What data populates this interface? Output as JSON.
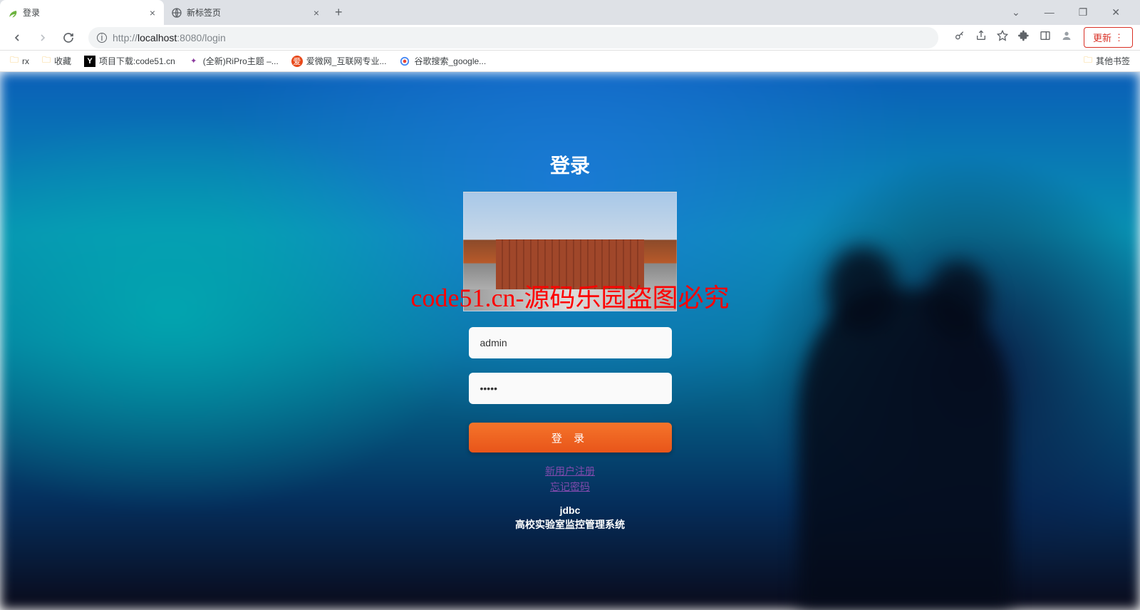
{
  "browser": {
    "tabs": [
      {
        "title": "登录",
        "active": true,
        "favicon": "leaf"
      },
      {
        "title": "新标签页",
        "active": false,
        "favicon": "globe"
      }
    ],
    "url_protocol": "http://",
    "url_host": "localhost",
    "url_port": ":8080",
    "url_path": "/login",
    "update_label": "更新",
    "window_controls": {
      "dropdown": "⌄",
      "minimize": "—",
      "maximize": "❐",
      "close": "✕"
    }
  },
  "bookmarks": {
    "items": [
      {
        "label": "rx",
        "icon": "folder"
      },
      {
        "label": "收藏",
        "icon": "folder"
      },
      {
        "label": "项目下载:code51.cn",
        "icon": "y"
      },
      {
        "label": "(全新)RiPro主题 –...",
        "icon": "purple"
      },
      {
        "label": "爱微网_互联网专业...",
        "icon": "red"
      },
      {
        "label": "谷歌搜索_google...",
        "icon": "g"
      }
    ],
    "other_label": "其他书签"
  },
  "login": {
    "title": "登录",
    "username_value": "admin",
    "password_value": "•••••",
    "button_label": "登 录",
    "register_link": "新用户注册",
    "forgot_link": "忘记密码",
    "footer_line1": "jdbc",
    "footer_line2": "高校实验室监控管理系统"
  },
  "watermark": "code51.cn-源码乐园盗图必究"
}
